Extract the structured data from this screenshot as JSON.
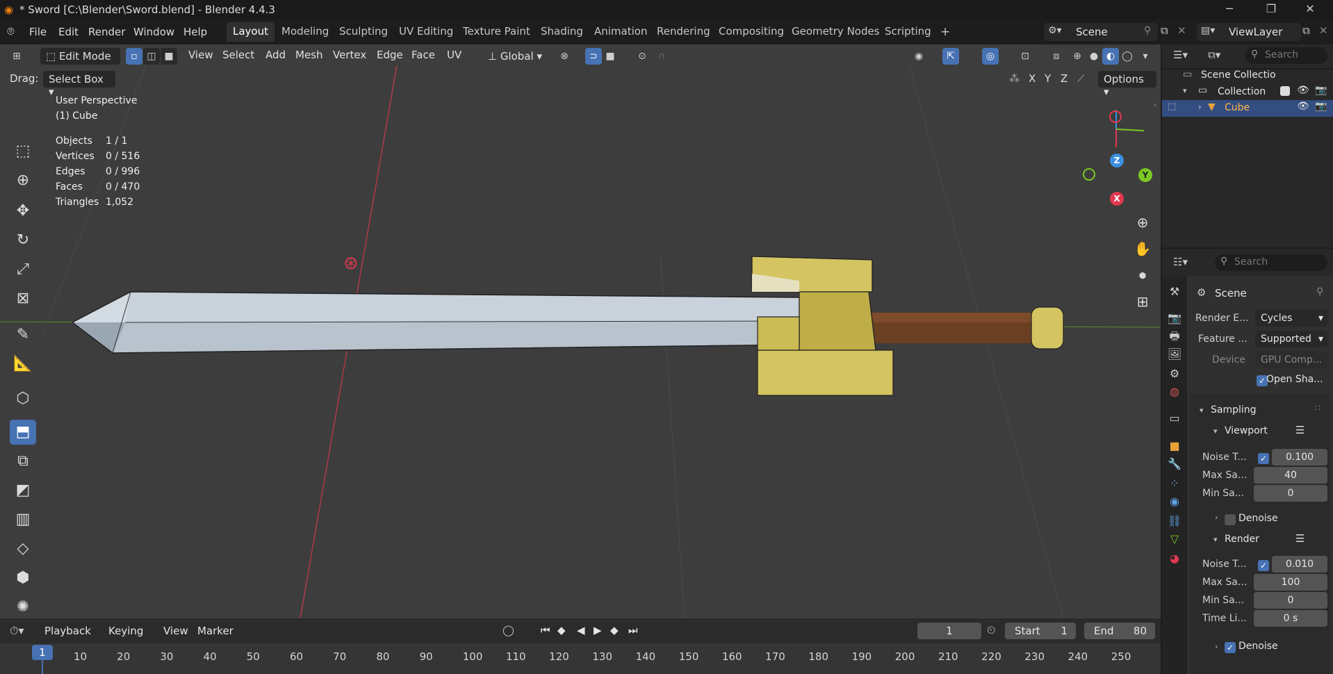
{
  "titlebar": {
    "title": "* Sword [C:\\Blender\\Sword.blend] - Blender 4.4.3",
    "minimize": "─",
    "maximize": "❐",
    "close": "✕"
  },
  "menubar": {
    "menus": [
      "File",
      "Edit",
      "Render",
      "Window",
      "Help"
    ],
    "workspaces": [
      "Layout",
      "Modeling",
      "Sculpting",
      "UV Editing",
      "Texture Paint",
      "Shading",
      "Animation",
      "Rendering",
      "Compositing",
      "Geometry Nodes",
      "Scripting"
    ],
    "active_workspace": "Layout",
    "add_workspace": "+",
    "scene": "Scene",
    "view_layer": "ViewLayer"
  },
  "viewport_header": {
    "mode": "Edit Mode",
    "menus": [
      "View",
      "Select",
      "Add",
      "Mesh",
      "Vertex",
      "Edge",
      "Face",
      "UV"
    ],
    "transform_orientation": "Global",
    "drag_label": "Drag:",
    "drag_value": "Select Box",
    "axes": [
      "X",
      "Y",
      "Z"
    ],
    "options": "Options"
  },
  "overlay": {
    "perspective": "User Perspective",
    "object": "(1) Cube",
    "stats": [
      {
        "label": "Objects",
        "value": "1 / 1"
      },
      {
        "label": "Vertices",
        "value": "0 / 516"
      },
      {
        "label": "Edges",
        "value": "0 / 996"
      },
      {
        "label": "Faces",
        "value": "0 / 470"
      },
      {
        "label": "Triangles",
        "value": "1,052"
      }
    ]
  },
  "gizmo": {
    "x": "X",
    "y": "Y",
    "z": "Z"
  },
  "timeline": {
    "menus": [
      "Playback",
      "Keying",
      "View",
      "Marker"
    ],
    "current_frame": "1",
    "start_label": "Start",
    "start": "1",
    "end_label": "End",
    "end": "80",
    "ruler": [
      "1",
      "10",
      "20",
      "30",
      "40",
      "50",
      "60",
      "70",
      "80",
      "90",
      "100",
      "110",
      "120",
      "130",
      "140",
      "150",
      "160",
      "170",
      "180",
      "190",
      "200",
      "210",
      "220",
      "230",
      "240",
      "250"
    ]
  },
  "outliner": {
    "search_placeholder": "Search",
    "root": "Scene Collectio",
    "collection": "Collection",
    "object": "Cube"
  },
  "properties": {
    "search_placeholder": "Search",
    "context": "Scene",
    "render_engine_label": "Render E...",
    "render_engine": "Cycles",
    "feature_label": "Feature ...",
    "feature": "Supported",
    "device_label": "Device",
    "device": "GPU Comp...",
    "open_shading": "Open Sha...",
    "sampling": "Sampling",
    "viewport": "Viewport",
    "vp_noise_label": "Noise T...",
    "vp_noise": "0.100",
    "vp_max_label": "Max Sa...",
    "vp_max": "40",
    "vp_min_label": "Min Sa...",
    "vp_min": "0",
    "denoise": "Denoise",
    "render": "Render",
    "r_noise_label": "Noise T...",
    "r_noise": "0.010",
    "r_max_label": "Max Sa...",
    "r_max": "100",
    "r_min_label": "Min Sa...",
    "r_min": "0",
    "time_label": "Time Li...",
    "time": "0 s",
    "denoise2": "Denoise"
  },
  "colors": {
    "accent": "#4772b3",
    "blade": "#b9c3cd",
    "guard": "#d4c562",
    "handle": "#6b3f22",
    "x_axis": "#e0384f",
    "y_axis": "#7cc924",
    "z_axis": "#3b8fe0"
  }
}
